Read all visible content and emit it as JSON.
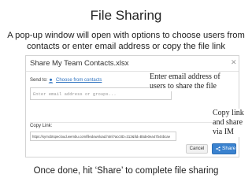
{
  "slide": {
    "title": "File Sharing",
    "subtitle": "A pop-up window will open with options to choose users from contacts or enter email address or copy the file link",
    "footer": "Once done, hit ‘Share’ to complete file sharing"
  },
  "dialog": {
    "title": "Share My Team Contacts.xlsx",
    "close_icon": "close-icon",
    "send_to_label": "Send to:",
    "choose_contacts_link": "Choose from contacts",
    "contacts_icon": "contacts-icon",
    "email_placeholder": "Enter email address or groups...",
    "copy_link_label": "Copy Link:",
    "link_value": "https://symcbtspecloud.wembu.com/filedownload.html?acctID=313&fid=B5de0ea47b44bcae",
    "cancel_label": "Cancel",
    "share_label": "Share",
    "share_icon": "share-icon"
  },
  "callouts": {
    "email": "Enter email address of users to share the file",
    "copy": "Copy link and share via IM"
  },
  "colors": {
    "link": "#2f73c0",
    "share_button": "#3a82cf"
  }
}
